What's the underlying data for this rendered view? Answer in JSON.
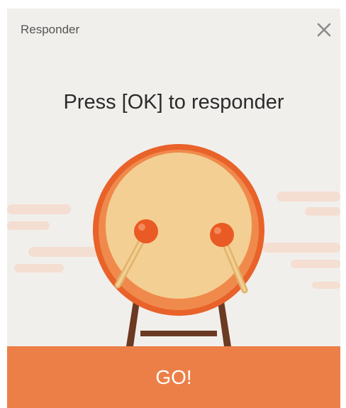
{
  "dialog": {
    "title": "Responder",
    "prompt": "Press [OK] to responder",
    "go_label": "GO!"
  },
  "icons": {
    "close": "close-icon",
    "drum": "drum-illustration"
  },
  "colors": {
    "background": "#f1efec",
    "accent": "#ec7f48",
    "drum_rim": "#e8622a",
    "drum_face": "#f3cf93"
  }
}
